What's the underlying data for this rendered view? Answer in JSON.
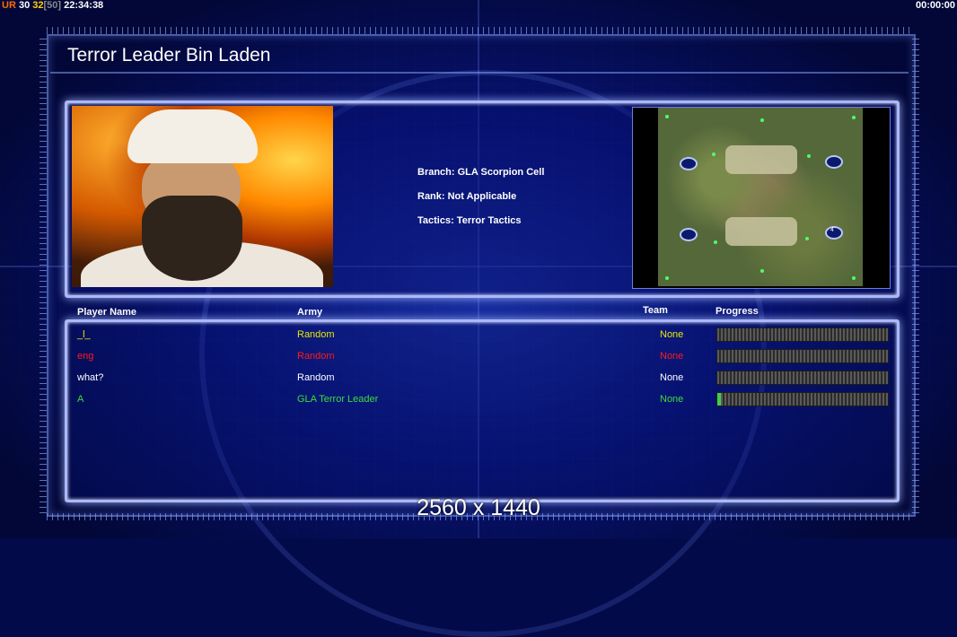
{
  "hud": {
    "prefix": "UR",
    "current": "30",
    "power": "32",
    "cap": "[50]",
    "clock": "22:34:38",
    "timer": "00:00:00"
  },
  "title": "Terror Leader Bin Laden",
  "general": {
    "branch": "Branch: GLA Scorpion Cell",
    "rank": "Rank: Not Applicable",
    "tactics": "Tactics: Terror Tactics"
  },
  "minimap": {
    "start_number": "4"
  },
  "table": {
    "headers": {
      "player": "Player Name",
      "army": "Army",
      "team": "Team",
      "progress": "Progress"
    },
    "rows": [
      {
        "name": "_l_",
        "army": "Random",
        "team": "None",
        "color": "#e8e800",
        "progress": 0
      },
      {
        "name": "eng",
        "army": "Random",
        "team": "None",
        "color": "#ff1a1a",
        "progress": 0
      },
      {
        "name": "what?",
        "army": "Random",
        "team": "None",
        "color": "#ffffff",
        "progress": 0
      },
      {
        "name": "A",
        "army": "GLA Terror Leader",
        "team": "None",
        "color": "#3cdc3c",
        "progress": 0.02
      }
    ]
  },
  "resolution": "2560 x 1440"
}
